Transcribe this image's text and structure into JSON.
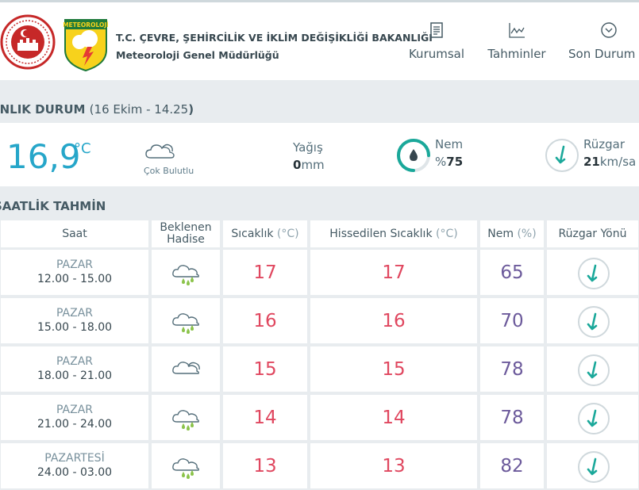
{
  "header": {
    "org_title": "T.C. ÇEVRE, ŞEHİRCİLİK VE İKLİM DEĞİŞİKLİĞİ BAKANLIĞI",
    "org_sub": "Meteoroloji Genel Müdürlüğü",
    "met_logo_text": "METEOROLOJİ",
    "nav": [
      {
        "label": "Kurumsal",
        "icon": "document-icon"
      },
      {
        "label": "Tahminler",
        "icon": "chart-icon"
      },
      {
        "label": "Son Durum",
        "icon": "chevron-circle-icon"
      }
    ]
  },
  "current": {
    "section_title": "ANLIK DURUM",
    "section_time": "16 Ekim - 14.25",
    "temperature": "16,9",
    "temperature_unit": "°C",
    "condition": "Çok Bulutlu",
    "rain_label": "Yağış",
    "rain_value": "0",
    "rain_unit": "mm",
    "humidity_label": "Nem",
    "humidity_prefix": "%",
    "humidity_value": "75",
    "humidity_fraction": 0.75,
    "wind_label": "Rüzgar",
    "wind_value": "21",
    "wind_unit": "km/sa"
  },
  "hourly": {
    "section_title": "SAATLİK TAHMİN",
    "columns": {
      "time": "Saat",
      "event": "Beklenen Hadise",
      "temp": "Sıcaklık",
      "temp_unit": "(°C)",
      "feels": "Hissedilen Sıcaklık",
      "feels_unit": "(°C)",
      "humidity": "Nem",
      "humidity_unit": "(%)",
      "wind_dir": "Rüzgar Yönü"
    },
    "rows": [
      {
        "day": "PAZAR",
        "hours": "12.00 - 15.00",
        "icon": "cloud-rain-icon",
        "temp": "17",
        "feels": "17",
        "humidity": "65"
      },
      {
        "day": "PAZAR",
        "hours": "15.00 - 18.00",
        "icon": "cloud-rain-icon",
        "temp": "16",
        "feels": "16",
        "humidity": "70"
      },
      {
        "day": "PAZAR",
        "hours": "18.00 - 21.00",
        "icon": "cloud-icon",
        "temp": "15",
        "feels": "15",
        "humidity": "78"
      },
      {
        "day": "PAZAR",
        "hours": "21.00 - 24.00",
        "icon": "cloud-rain-icon",
        "temp": "14",
        "feels": "14",
        "humidity": "78"
      },
      {
        "day": "PAZARTESİ",
        "hours": "24.00 - 03.00",
        "icon": "cloud-rain-icon",
        "temp": "13",
        "feels": "13",
        "humidity": "82"
      }
    ]
  },
  "colors": {
    "accent_blue": "#26a6c9",
    "teal": "#1aa89a",
    "temp_red": "#e0475f",
    "humidity_purple": "#6c5a9b"
  }
}
